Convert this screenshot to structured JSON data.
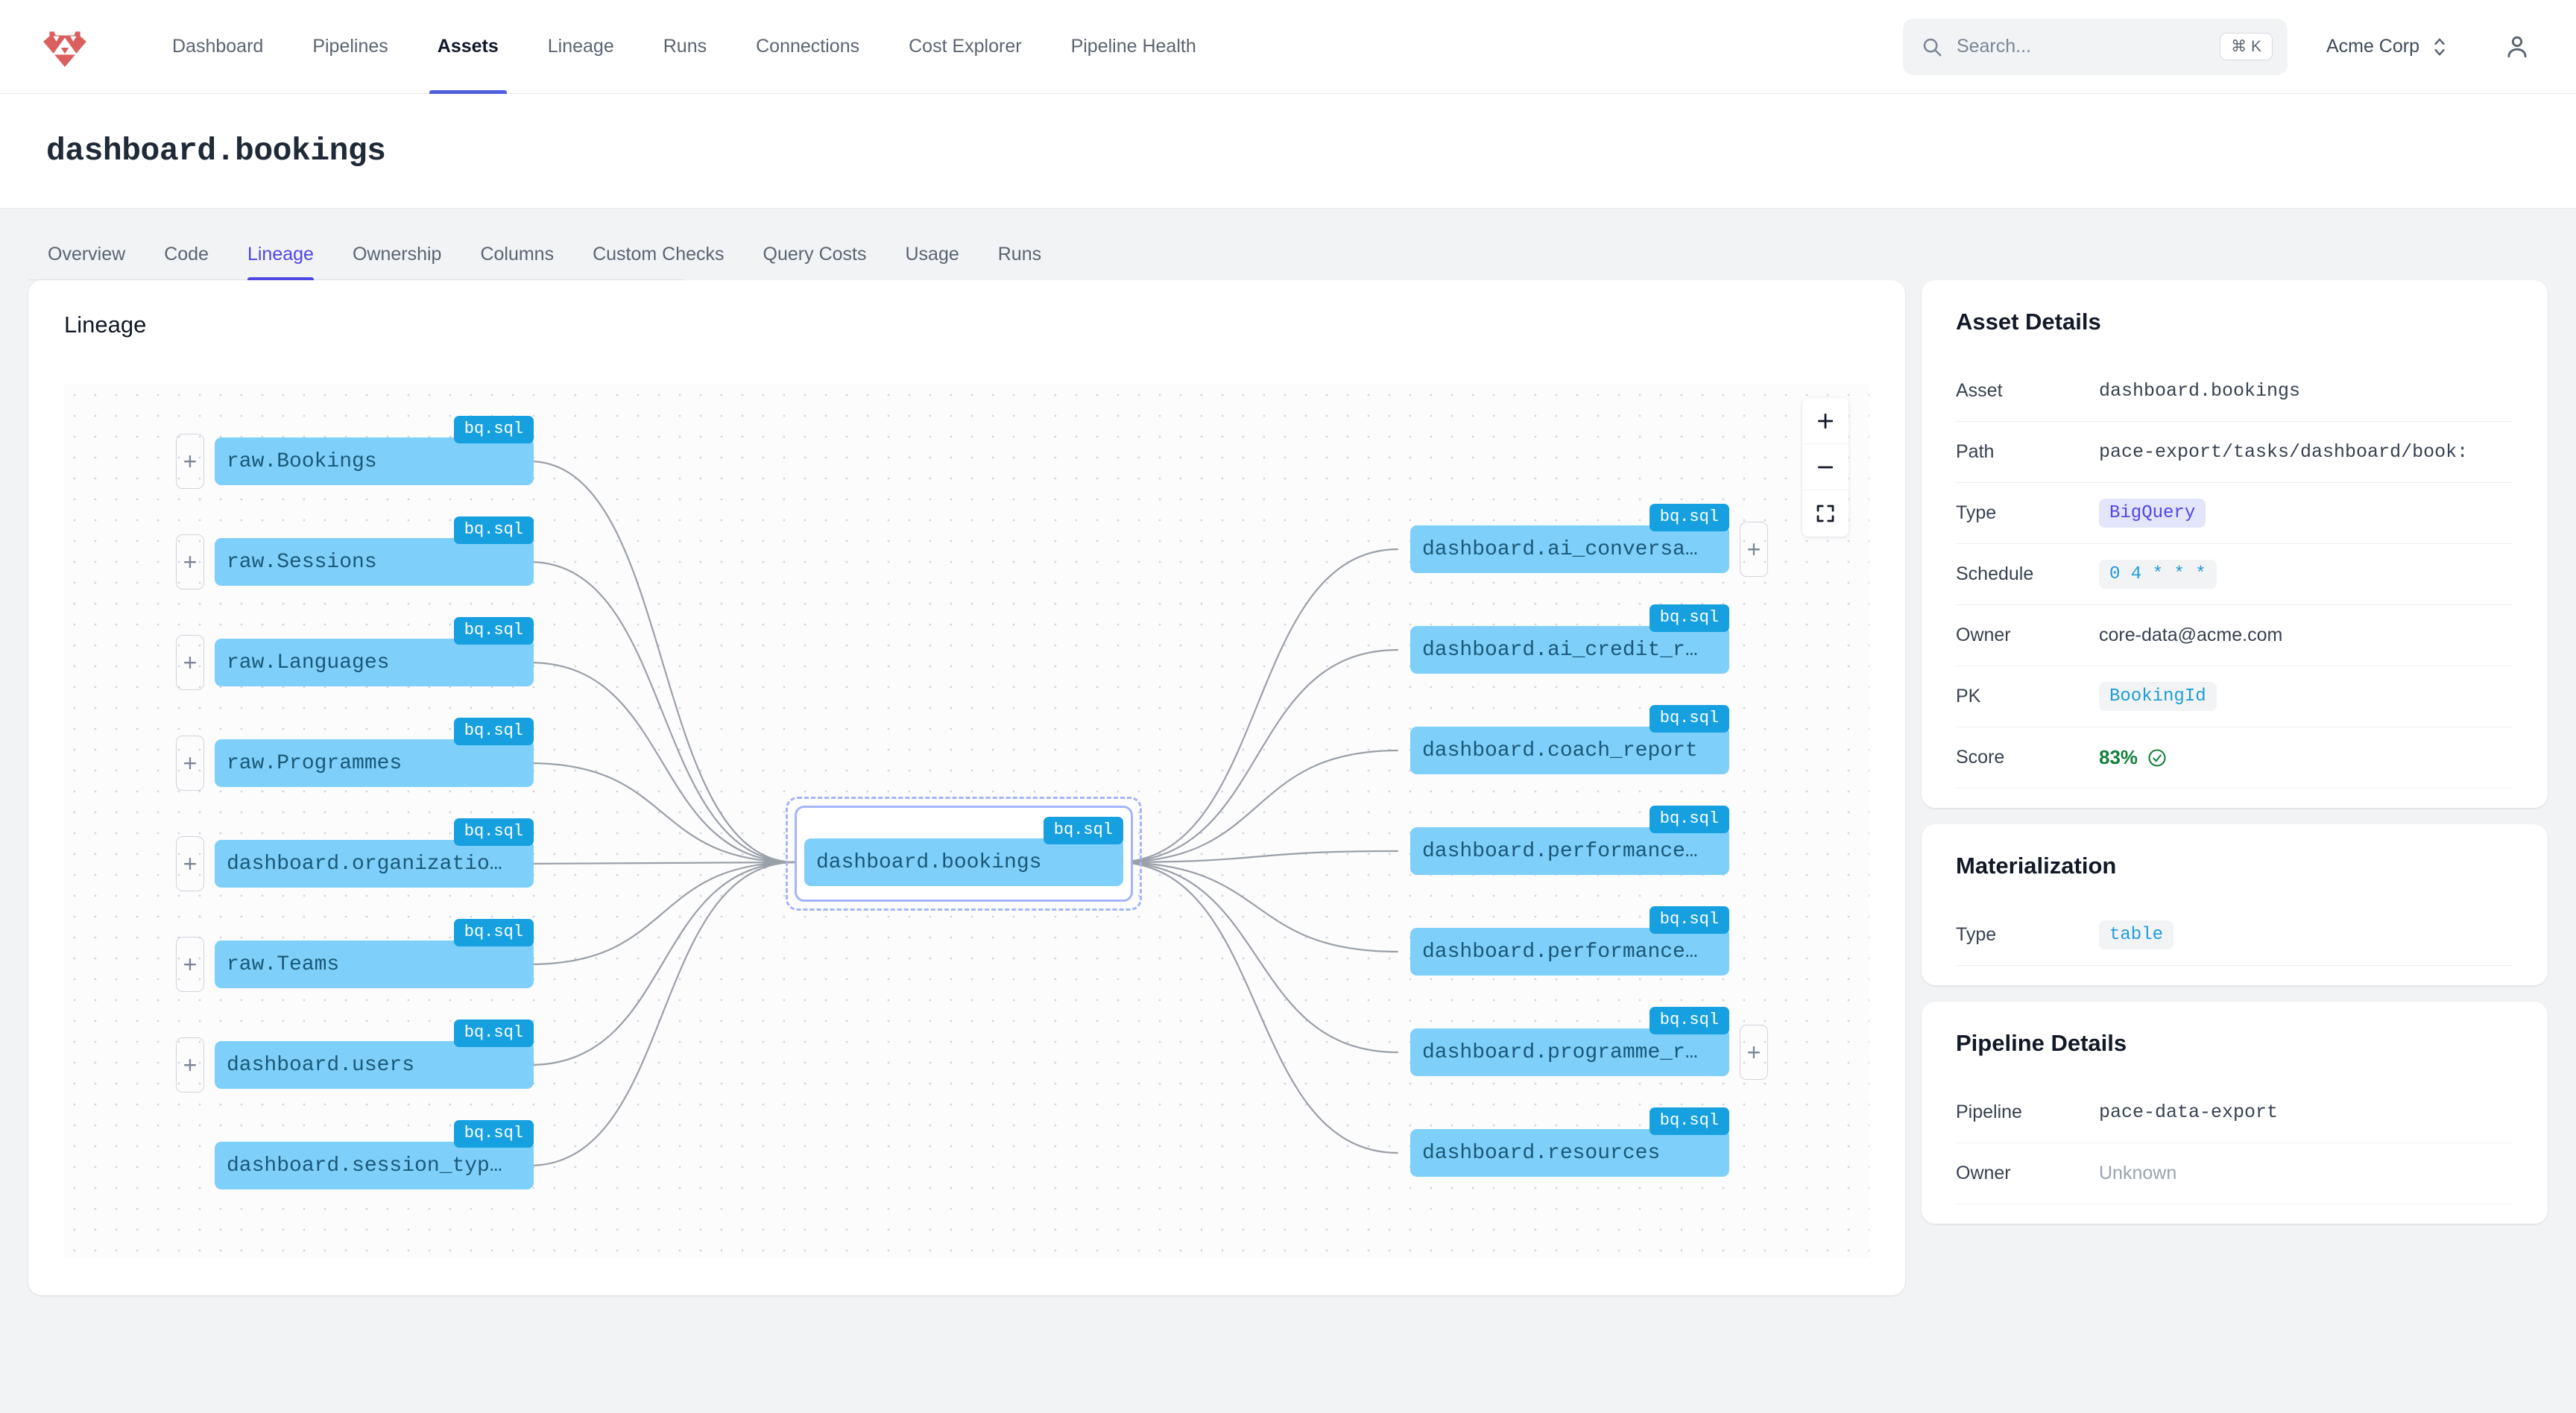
{
  "nav": {
    "logo_icon": "bruin-bear-diamond-logo",
    "items": [
      {
        "label": "Dashboard",
        "active": false
      },
      {
        "label": "Pipelines",
        "active": false
      },
      {
        "label": "Assets",
        "active": true
      },
      {
        "label": "Lineage",
        "active": false
      },
      {
        "label": "Runs",
        "active": false
      },
      {
        "label": "Connections",
        "active": false
      },
      {
        "label": "Cost Explorer",
        "active": false
      },
      {
        "label": "Pipeline Health",
        "active": false
      }
    ],
    "search": {
      "placeholder": "Search...",
      "shortcut": "⌘ K",
      "icon": "search-icon"
    },
    "org": {
      "name": "Acme Corp",
      "icon": "chevron-updown-icon"
    },
    "account_icon": "user-avatar-icon"
  },
  "header": {
    "title": "dashboard.bookings"
  },
  "tabs": [
    {
      "label": "Overview",
      "active": false
    },
    {
      "label": "Code",
      "active": false
    },
    {
      "label": "Lineage",
      "active": true
    },
    {
      "label": "Ownership",
      "active": false
    },
    {
      "label": "Columns",
      "active": false
    },
    {
      "label": "Custom Checks",
      "active": false
    },
    {
      "label": "Query Costs",
      "active": false
    },
    {
      "label": "Usage",
      "active": false
    },
    {
      "label": "Runs",
      "active": false
    }
  ],
  "lineage": {
    "card_title": "Lineage",
    "badge_text": "bq.sql",
    "expand_symbol": "+",
    "zoom_controls": [
      {
        "name": "zoom-in",
        "symbol": "+"
      },
      {
        "name": "zoom-out",
        "symbol": "−"
      },
      {
        "name": "fit-view",
        "symbol": "fit"
      }
    ],
    "focus_node": {
      "label": "dashboard.bookings",
      "badge": "bq.sql"
    },
    "upstream": [
      {
        "label": "raw.Bookings",
        "badge": "bq.sql",
        "expandable": true
      },
      {
        "label": "raw.Sessions",
        "badge": "bq.sql",
        "expandable": true
      },
      {
        "label": "raw.Languages",
        "badge": "bq.sql",
        "expandable": true
      },
      {
        "label": "raw.Programmes",
        "badge": "bq.sql",
        "expandable": true
      },
      {
        "label": "dashboard.organizatio…",
        "badge": "bq.sql",
        "expandable": true
      },
      {
        "label": "raw.Teams",
        "badge": "bq.sql",
        "expandable": true
      },
      {
        "label": "dashboard.users",
        "badge": "bq.sql",
        "expandable": true
      },
      {
        "label": "dashboard.session_typ…",
        "badge": "bq.sql",
        "expandable": false
      }
    ],
    "downstream": [
      {
        "label": "dashboard.ai_conversa…",
        "badge": "bq.sql",
        "expandable": true
      },
      {
        "label": "dashboard.ai_credit_r…",
        "badge": "bq.sql",
        "expandable": false
      },
      {
        "label": "dashboard.coach_report",
        "badge": "bq.sql",
        "expandable": false
      },
      {
        "label": "dashboard.performance…",
        "badge": "bq.sql",
        "expandable": false
      },
      {
        "label": "dashboard.performance…",
        "badge": "bq.sql",
        "expandable": false
      },
      {
        "label": "dashboard.programme_r…",
        "badge": "bq.sql",
        "expandable": true
      },
      {
        "label": "dashboard.resources",
        "badge": "bq.sql",
        "expandable": false
      }
    ]
  },
  "asset_details": {
    "title": "Asset Details",
    "rows": [
      {
        "key": "Asset",
        "value": "dashboard.bookings",
        "style": "mono"
      },
      {
        "key": "Path",
        "value": "pace-export/tasks/dashboard/book:",
        "style": "mono"
      },
      {
        "key": "Type",
        "value": "BigQuery",
        "style": "chip-type"
      },
      {
        "key": "Schedule",
        "value": "0 4 * * *",
        "style": "chip-code"
      },
      {
        "key": "Owner",
        "value": "core-data@acme.com",
        "style": "sans"
      },
      {
        "key": "PK",
        "value": "BookingId",
        "style": "chip-code"
      },
      {
        "key": "Score",
        "value": "83%",
        "style": "score",
        "icon": "check-circle-icon"
      }
    ]
  },
  "materialization": {
    "title": "Materialization",
    "rows": [
      {
        "key": "Type",
        "value": "table",
        "style": "chip-code"
      }
    ]
  },
  "pipeline_details": {
    "title": "Pipeline Details",
    "rows": [
      {
        "key": "Pipeline",
        "value": "pace-data-export",
        "style": "mono"
      },
      {
        "key": "Owner",
        "value": "Unknown",
        "style": "muted"
      }
    ]
  },
  "colors": {
    "brand_red": "#d9605f",
    "accent_indigo": "#4f46e5",
    "node_blue": "#7ed0fa",
    "badge_blue": "#16a0e0",
    "score_green": "#15803d"
  }
}
